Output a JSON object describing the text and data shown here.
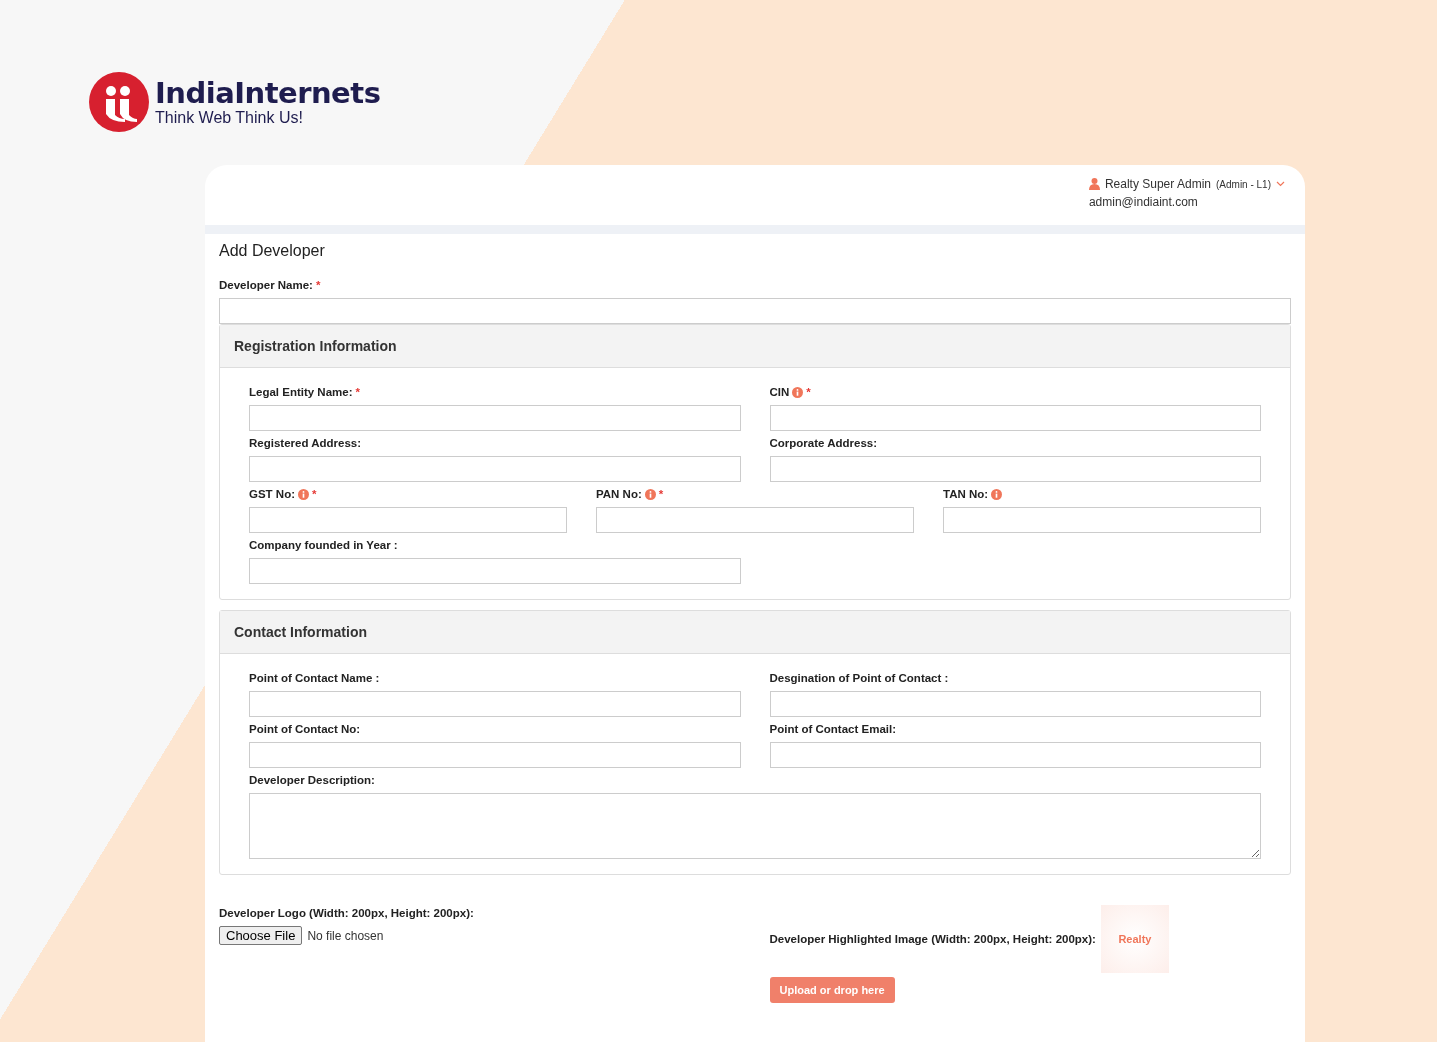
{
  "brand": {
    "name": "IndiaInternets",
    "tagline": "Think Web Think Us!"
  },
  "user": {
    "name": "Realty Super Admin",
    "role": "(Admin - L1)",
    "email": "admin@indiaint.com"
  },
  "page_title": "Add Developer",
  "developer_name": {
    "label": "Developer Name:",
    "required_mark": "*",
    "info": false
  },
  "sections": [
    {
      "title": "Registration Information",
      "rows": [
        [
          {
            "label": "Legal Entity Name:",
            "required_mark": "*",
            "info": false,
            "kind": "input"
          },
          {
            "label": "CIN",
            "required_mark": "*",
            "info": true,
            "kind": "input"
          }
        ],
        [
          {
            "label": "Registered Address:",
            "info": false,
            "kind": "input"
          },
          {
            "label": "Corporate Address:",
            "info": false,
            "kind": "input"
          }
        ],
        [
          {
            "label": "GST No:",
            "required_mark": "*",
            "info": true,
            "kind": "input"
          },
          {
            "label": "PAN No:",
            "required_mark": "*",
            "info": true,
            "kind": "input"
          },
          {
            "label": "TAN No:",
            "info": true,
            "kind": "input"
          }
        ],
        [
          {
            "label": "Company founded in Year :",
            "info": false,
            "kind": "input"
          }
        ]
      ]
    },
    {
      "title": "Contact Information",
      "rows": [
        [
          {
            "label": "Point of Contact Name :",
            "info": false,
            "kind": "input"
          },
          {
            "label": "Desgination of Point of Contact :",
            "info": false,
            "kind": "input"
          }
        ],
        [
          {
            "label": "Point of Contact No:",
            "info": false,
            "kind": "input"
          },
          {
            "label": "Point of Contact Email:",
            "info": false,
            "kind": "input"
          }
        ],
        [
          {
            "label": "Developer Description:",
            "info": false,
            "kind": "textarea"
          }
        ]
      ]
    }
  ],
  "uploads": {
    "logo": {
      "label": "Developer Logo (Width: 200px, Height: 200px):",
      "button": "Choose File",
      "status": "No file chosen"
    },
    "highlight": {
      "label": "Developer Highlighted Image (Width: 200px, Height: 200px):",
      "preview_text": "Realty",
      "button": "Upload or drop here"
    }
  }
}
